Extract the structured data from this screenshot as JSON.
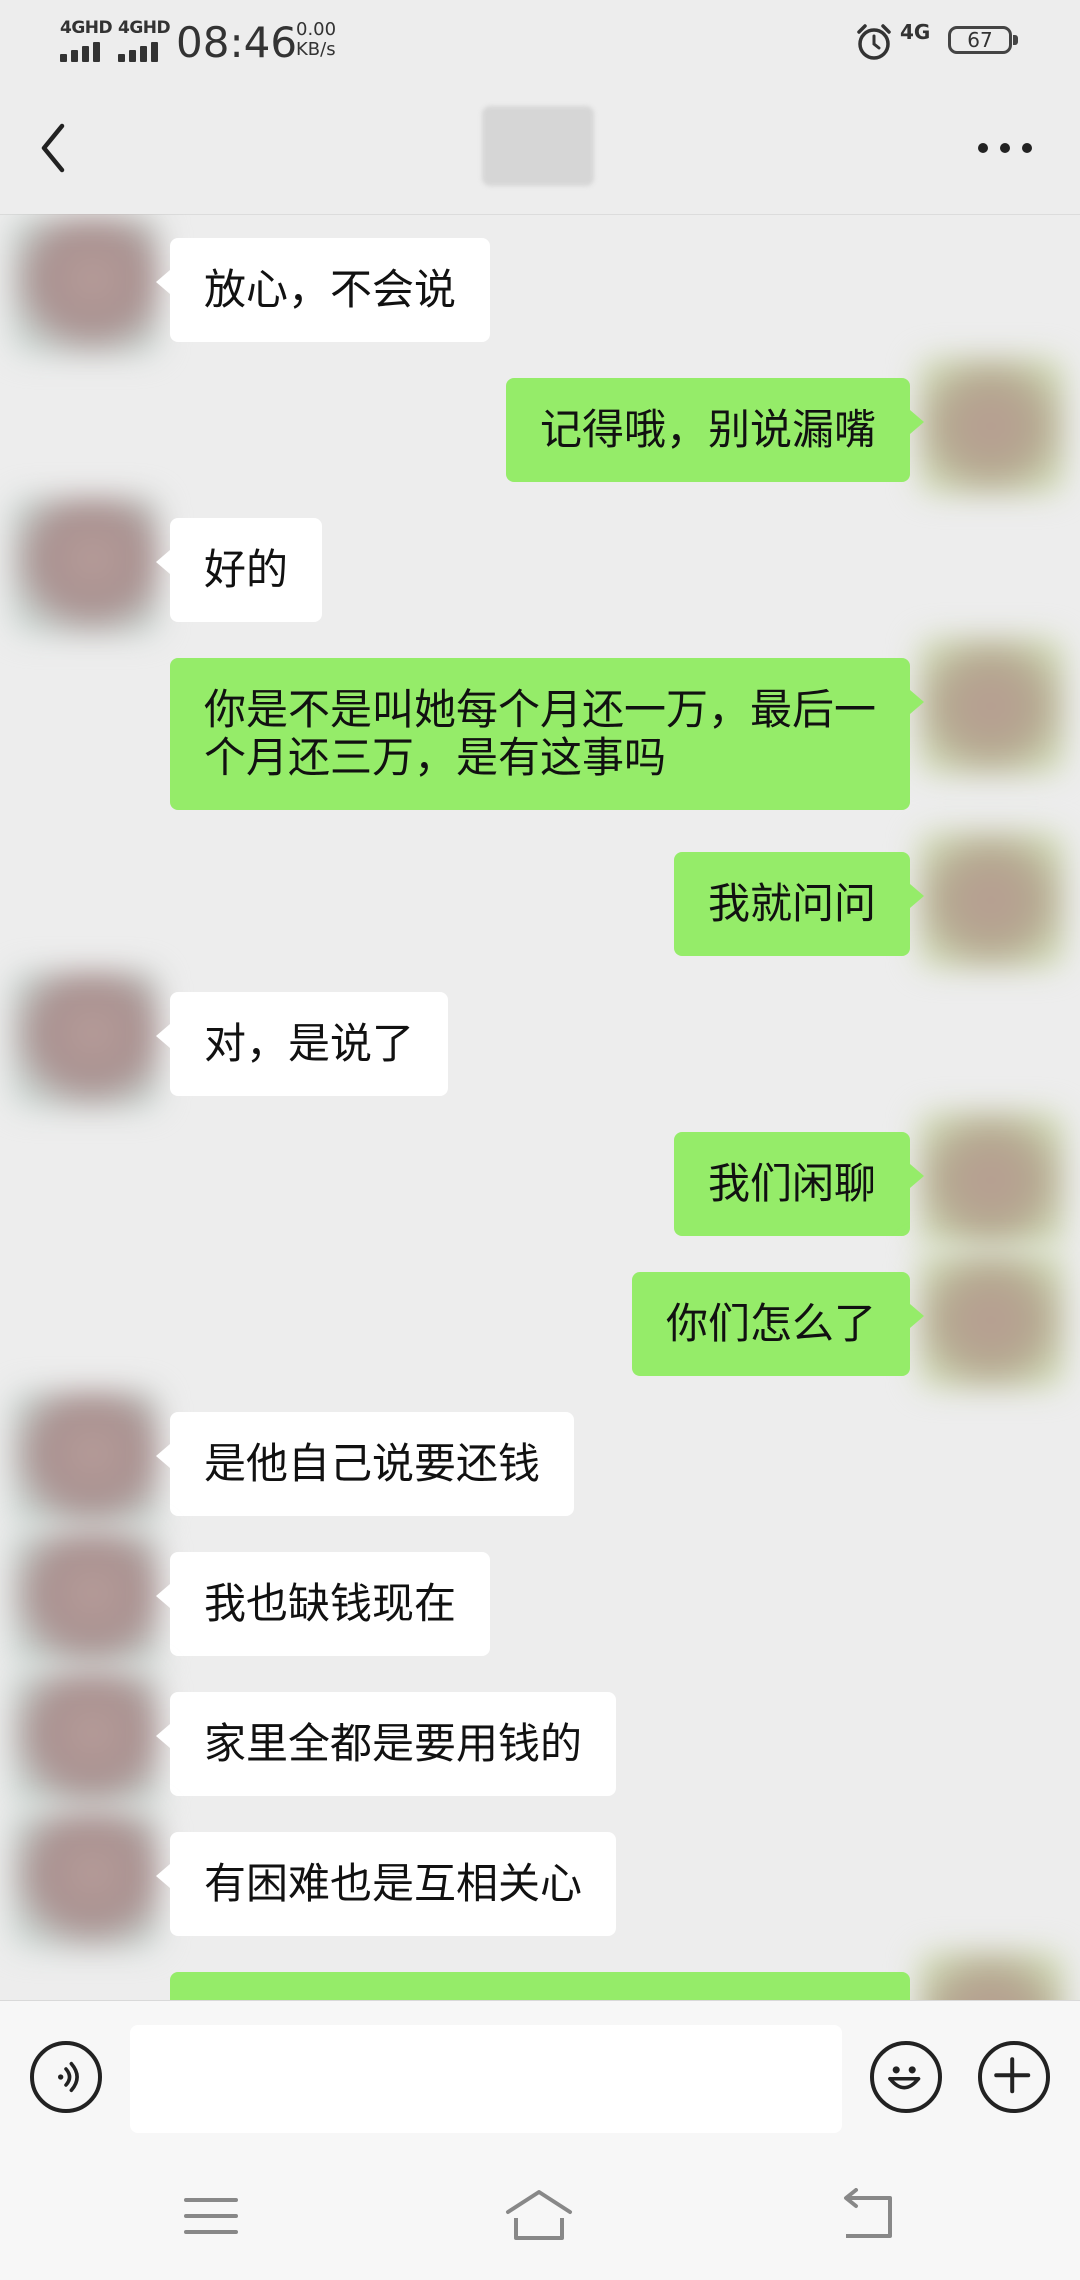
{
  "status_bar": {
    "sim1": "4GHD",
    "sim2": "4GHD",
    "time": "08:46",
    "speed_value": "0.00",
    "speed_unit": "KB/s",
    "network": "4G",
    "battery": "67"
  },
  "nav": {
    "back_icon": "chevron-left-icon",
    "more_icon": "more-icon"
  },
  "messages": [
    {
      "side": "in",
      "text": "放心，不会说"
    },
    {
      "side": "out",
      "text": "记得哦，别说漏嘴"
    },
    {
      "side": "in",
      "text": "好的"
    },
    {
      "side": "out",
      "text": "你是不是叫她每个月还一万，最后一个月还三万，是有这事吗"
    },
    {
      "side": "out",
      "text": "我就问问"
    },
    {
      "side": "in",
      "text": "对，是说了"
    },
    {
      "side": "out",
      "text": "我们闲聊"
    },
    {
      "side": "out",
      "text": "你们怎么了"
    },
    {
      "side": "in",
      "text": "是他自己说要还钱"
    },
    {
      "side": "in",
      "text": "我也缺钱现在"
    },
    {
      "side": "in",
      "text": "家里全都是要用钱的"
    },
    {
      "side": "in",
      "text": "有困难也是互相关心"
    },
    {
      "side": "out",
      "text": ""
    }
  ],
  "input_bar": {
    "voice_icon": "voice-icon",
    "emoji_icon": "emoji-icon",
    "plus_icon": "plus-icon",
    "input_value": ""
  },
  "system_nav": {
    "menu_icon": "menu-icon",
    "home_icon": "home-icon",
    "back_icon": "back-icon"
  },
  "colors": {
    "background": "#ededed",
    "incoming_bubble": "#ffffff",
    "outgoing_bubble": "#95ec69",
    "bar_background": "#f7f7f7"
  }
}
